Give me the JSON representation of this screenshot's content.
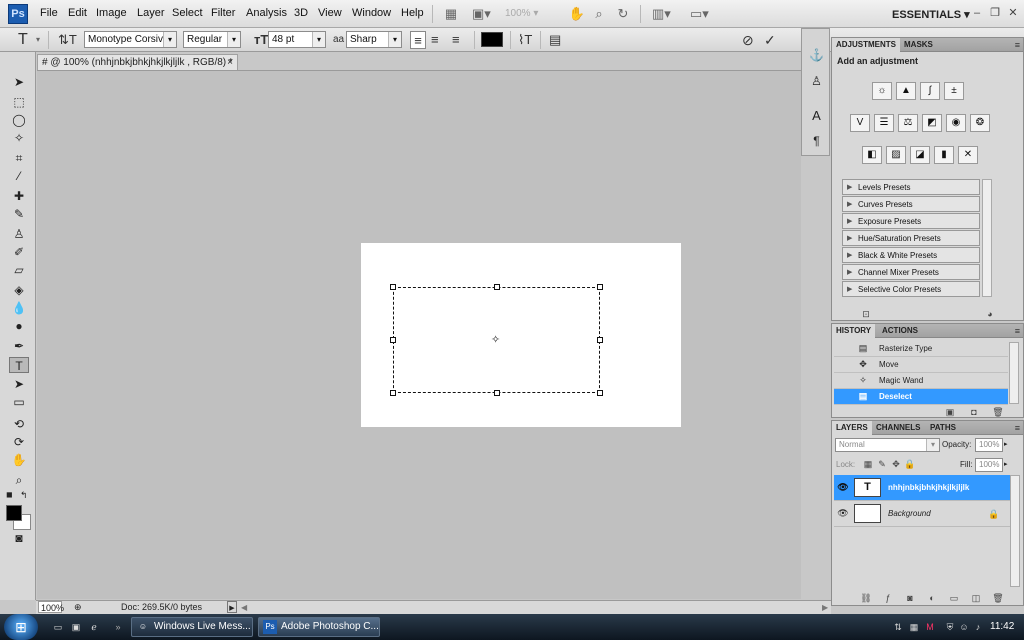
{
  "app": {
    "logo": "Ps",
    "workspace": "ESSENTIALS"
  },
  "menus": [
    "File",
    "Edit",
    "Image",
    "Layer",
    "Select",
    "Filter",
    "Analysis",
    "3D",
    "View",
    "Window",
    "Help"
  ],
  "appbar": {
    "zoom": "100%"
  },
  "options": {
    "font_family": "Monotype Corsiva",
    "font_style": "Regular",
    "font_size": "48 pt",
    "antialias_glyph": "aa",
    "antialias": "Sharp",
    "text_color": "#000000"
  },
  "document": {
    "tab_title": "# @ 100% (nhhjnbkjbhkjhkjlkjljlk , RGB/8) *",
    "close": "×"
  },
  "status": {
    "zoom": "100%",
    "doc": "Doc: 269.5K/0 bytes"
  },
  "adjustments": {
    "tabs": [
      "ADJUSTMENTS",
      "MASKS"
    ],
    "heading": "Add an adjustment",
    "presets": [
      "Levels Presets",
      "Curves Presets",
      "Exposure Presets",
      "Hue/Saturation Presets",
      "Black & White Presets",
      "Channel Mixer Presets",
      "Selective Color Presets"
    ]
  },
  "history": {
    "tabs": [
      "HISTORY",
      "ACTIONS"
    ],
    "items": [
      "Rasterize Type",
      "Move",
      "Magic Wand",
      "Deselect"
    ]
  },
  "layers": {
    "tabs": [
      "LAYERS",
      "CHANNELS",
      "PATHS"
    ],
    "blend_mode": "Normal",
    "opacity_label": "Opacity:",
    "opacity": "100%",
    "lock_label": "Lock:",
    "fill_label": "Fill:",
    "fill": "100%",
    "items": [
      {
        "name": "nhhjnbkjbhkjhkjlkjljlk",
        "thumb": "T"
      },
      {
        "name": "Background",
        "thumb": ""
      }
    ]
  },
  "taskbar": {
    "buttons": [
      "Windows Live Mess...",
      "Adobe Photoshop C..."
    ],
    "clock": "11:42"
  },
  "colors": {
    "selection": "#3399ff",
    "logo_bg": "#1c5db0"
  }
}
